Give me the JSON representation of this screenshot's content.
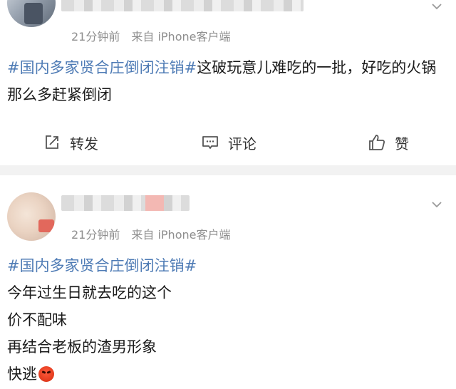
{
  "posts": [
    {
      "time": "21分钟前",
      "source": "来自 iPhone客户端",
      "hashtag": "#国内多家贤合庄倒闭注销#",
      "body": "这破玩意儿难吃的一批，好吃的火锅那么多赶紧倒闭",
      "actions": {
        "share": "转发",
        "comment": "评论",
        "like": "赞"
      }
    },
    {
      "time": "21分钟前",
      "source": "来自 iPhone客户端",
      "hashtag": "#国内多家贤合庄倒闭注销#",
      "lines": [
        "今年过生日就去吃的这个",
        "价不配味",
        "再结合老板的渣男形象",
        "快逃"
      ],
      "emoji": "angry-face-emoji"
    }
  ],
  "colors": {
    "hashtag": "#4e7bb5",
    "meta": "#8e8e8e",
    "divider": "#f2f2f2"
  }
}
